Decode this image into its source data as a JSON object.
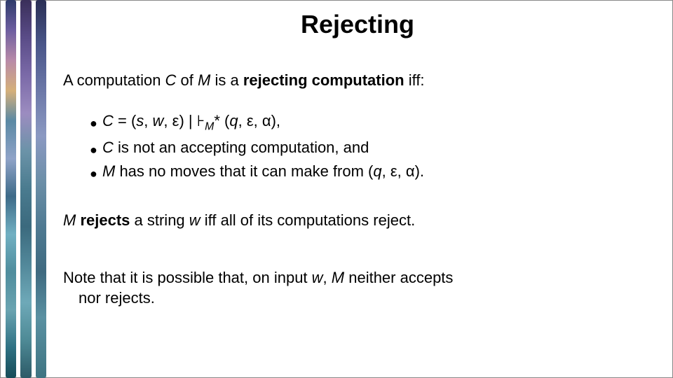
{
  "title": "Rejecting",
  "intro": {
    "pre": "A computation ",
    "C": "C",
    "mid1": " of ",
    "M": "M",
    "mid2": " is a ",
    "term": "rejecting computation",
    "post": " iff:"
  },
  "bullets": {
    "b1": {
      "C": "C",
      "eq": " = (",
      "s": "s",
      "c1": ", ",
      "w": "w",
      "c2": ", ε) | ⊦",
      "Msub": "M",
      "star": "* (",
      "q": "q",
      "c3": ", ε, α),"
    },
    "b2": {
      "C": "C",
      "rest": " is not an accepting computation, and"
    },
    "b3": {
      "M": "M",
      "mid": " has no moves that it can make from (",
      "q": "q",
      "rest": ", ε, α)."
    }
  },
  "rejects": {
    "M": "M",
    "sp": " ",
    "verb": "rejects",
    "mid": " a string ",
    "w": "w",
    "post": " iff all of its computations reject."
  },
  "note": {
    "l1a": "Note that it is possible that, on input ",
    "w": "w",
    "l1b": ", ",
    "M": "M",
    "l1c": " neither accepts",
    "l2": "nor rejects."
  }
}
